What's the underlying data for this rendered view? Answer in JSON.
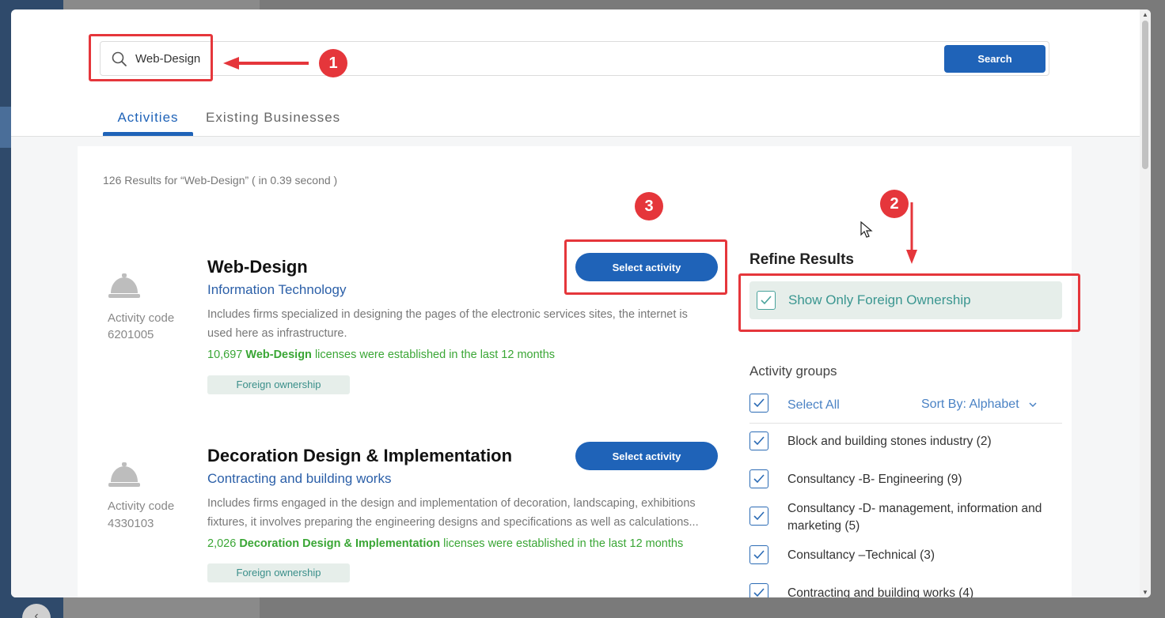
{
  "search": {
    "value": "Web-Design",
    "button_label": "Search"
  },
  "tabs": [
    {
      "label": "Activities",
      "active": true
    },
    {
      "label": "Existing Businesses",
      "active": false
    }
  ],
  "results": {
    "summary": "126 Results for “Web-Design” ( in 0.39 second )"
  },
  "activities": [
    {
      "title": "Web-Design",
      "category": "Information Technology",
      "code_label": "Activity code",
      "code": "6201005",
      "description": "Includes firms specialized in designing the pages of the electronic services sites, the internet is used here as infrastructure.",
      "stats_count": "10,697",
      "stats_name": "Web-Design",
      "stats_suffix": "licenses were established in the last 12 months",
      "badge": "Foreign ownership",
      "button_label": "Select activity",
      "icon": "bell-service-icon"
    },
    {
      "title": "Decoration Design & Implementation",
      "category": "Contracting and building works",
      "code_label": "Activity code",
      "code": "4330103",
      "description": "Includes firms engaged in the design and implementation of decoration, landscaping, exhibitions fixtures, it involves preparing the engineering designs and specifications as well as calculations...",
      "stats_count": "2,026",
      "stats_name": "Decoration Design & Implementation",
      "stats_suffix": "licenses were established in the last 12 months",
      "badge": "Foreign ownership",
      "button_label": "Select activity",
      "icon": "bell-service-icon"
    }
  ],
  "refine": {
    "title": "Refine Results",
    "foreign_only_label": "Show Only Foreign Ownership",
    "foreign_only_checked": true,
    "groups_title": "Activity groups",
    "select_all_label": "Select All",
    "sort_label": "Sort By: Alphabet",
    "groups": [
      {
        "label": "Block and building stones industry (2)",
        "checked": true
      },
      {
        "label": "Consultancy -B- Engineering (9)",
        "checked": true
      },
      {
        "label": "Consultancy -D- management, information and marketing (5)",
        "checked": true
      },
      {
        "label": "Consultancy –Technical (3)",
        "checked": true
      },
      {
        "label": "Contracting and building works (4)",
        "checked": true
      }
    ]
  },
  "annotations": {
    "step_1": "1",
    "step_2": "2",
    "step_3": "3",
    "color": "#e5363b"
  },
  "colors": {
    "primary": "#1f63b8",
    "stats_green": "#3aa635",
    "badge_bg": "#e6eeea",
    "badge_text": "#3a8f8a"
  }
}
